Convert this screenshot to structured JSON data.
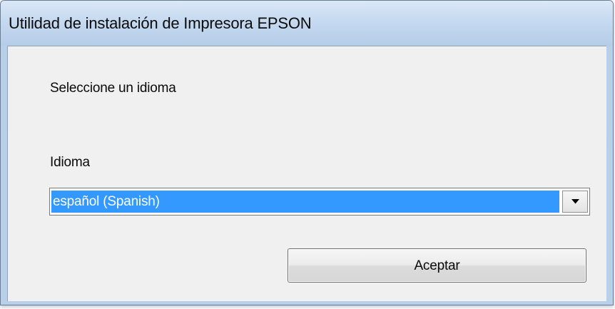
{
  "window": {
    "title": "Utilidad de instalación de Impresora EPSON"
  },
  "dialog": {
    "prompt": "Seleccione un idioma",
    "language_label": "Idioma",
    "language_select": {
      "selected": "español (Spanish)",
      "dropdown_icon": "chevron-down-icon"
    },
    "accept_label": "Aceptar"
  },
  "colors": {
    "selection_highlight": "#3399ff",
    "titlebar": "#c5d9f0",
    "client_background": "#f0f0f0"
  }
}
